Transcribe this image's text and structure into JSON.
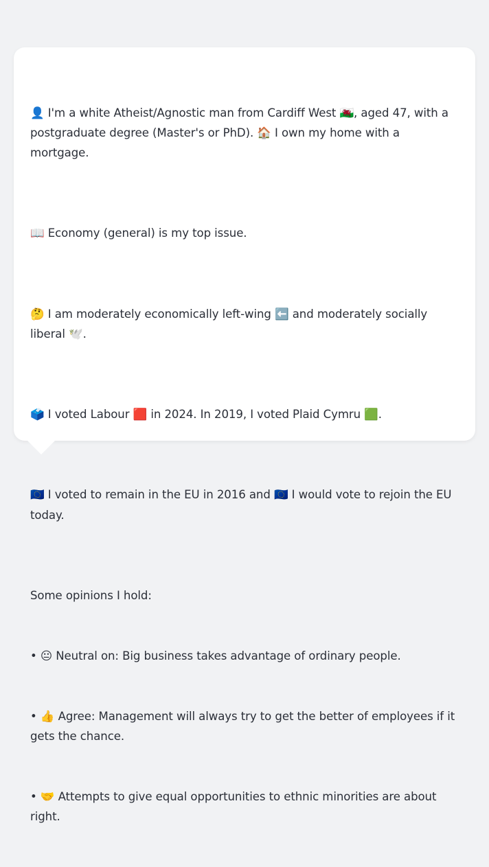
{
  "message": {
    "p1": "👤 I'm a white Atheist/Agnostic man from Cardiff West 🏴󠁧󠁢󠁷󠁬󠁳󠁿, aged 47, with a postgraduate degree (Master's or PhD). 🏠 I own my home with a mortgage.",
    "p2": "📖 Economy (general) is my top issue.",
    "p3": "🤔 I am moderately economically left-wing ⬅️ and moderately socially liberal 🕊️.",
    "p4": "🗳️ I voted Labour 🟥 in 2024. In 2019, I voted Plaid Cymru 🟩.",
    "p5": "🇪🇺 I voted to remain in the EU in 2016 and 🇪🇺 I would vote to rejoin the EU today.",
    "opinions_heading": "Some opinions I hold:",
    "opinions": [
      "• 😐 Neutral on: Big business takes advantage of ordinary people.",
      "• 👍 Agree: Management will always try to get the better of employees if it gets the chance.",
      "• 🤝 Attempts to give equal opportunities to ethnic minorities are about right."
    ]
  }
}
